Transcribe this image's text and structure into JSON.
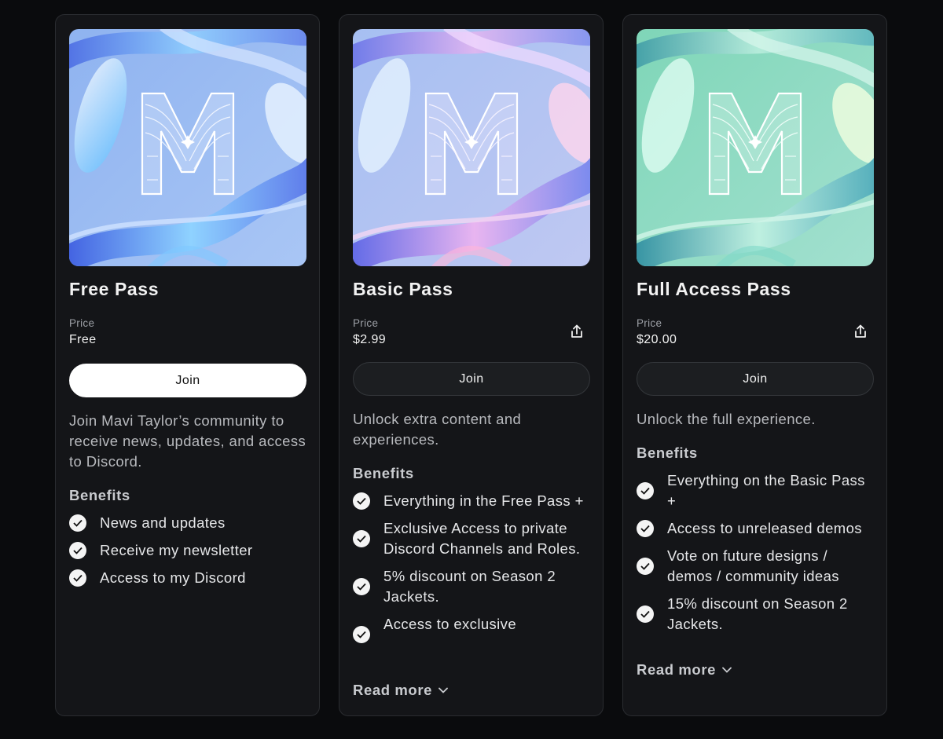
{
  "cards": [
    {
      "title": "Free Pass",
      "price_label": "Price",
      "price": "Free",
      "join_label": "Join",
      "description": "Join Mavi Taylor’s community to receive news, updates, and access to Discord.",
      "benefits_title": "Benefits",
      "benefits": [
        "News and updates",
        "Receive my newsletter",
        "Access to my Discord"
      ]
    },
    {
      "title": "Basic Pass",
      "price_label": "Price",
      "price": "$2.99",
      "join_label": "Join",
      "description": "Unlock extra content and experiences.",
      "benefits_title": "Benefits",
      "benefits": [
        "Everything in the Free Pass +",
        "Exclusive Access to private Discord Channels and Roles.",
        "5% discount on Season 2 Jackets.",
        "Access to exclusive"
      ],
      "read_more": "Read more"
    },
    {
      "title": "Full Access Pass",
      "price_label": "Price",
      "price": "$20.00",
      "join_label": "Join",
      "description": "Unlock the full experience.",
      "benefits_title": "Benefits",
      "benefits": [
        "Everything on the Basic Pass +",
        "Access to unreleased demos",
        "Vote on future designs / demos / community ideas",
        "15% discount on Season 2 Jackets."
      ],
      "read_more": "Read more"
    }
  ],
  "icons": {
    "share": "share-icon",
    "check": "check-circle-icon",
    "chevron": "chevron-down-icon",
    "art_logo": "m-logo-icon"
  },
  "colors": {
    "background": "#0a0b0d",
    "card": "#141518",
    "join_primary": "#ffffff",
    "join_secondary": "#1c1e21"
  }
}
